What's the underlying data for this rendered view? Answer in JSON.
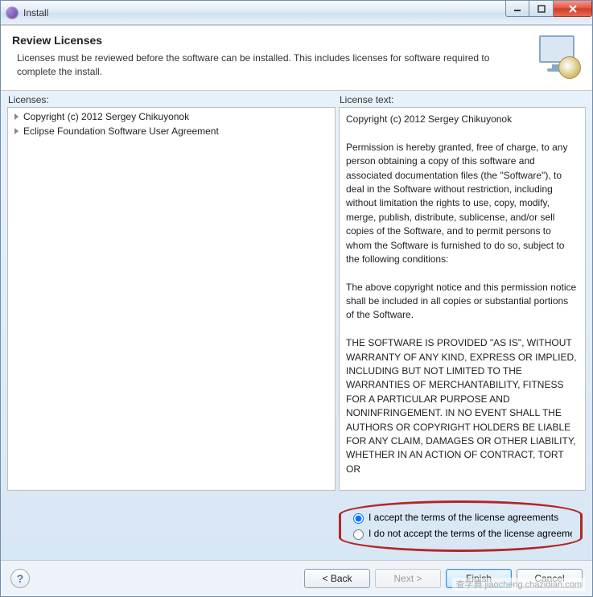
{
  "window": {
    "title": "Install"
  },
  "header": {
    "heading": "Review Licenses",
    "description": "Licenses must be reviewed before the software can be installed.  This includes licenses for software required to complete the install."
  },
  "labels": {
    "licenses": "Licenses:",
    "license_text": "License text:"
  },
  "licenses": {
    "items": [
      {
        "label": "Copyright (c) 2012 Sergey Chikuyonok"
      },
      {
        "label": "Eclipse Foundation Software User Agreement"
      }
    ]
  },
  "license_text": "Copyright (c) 2012 Sergey Chikuyonok\n\nPermission is hereby granted, free of charge, to any person obtaining a copy of this software and associated documentation files (the \"Software\"), to deal in the Software without restriction, including without limitation the rights to use, copy, modify, merge, publish, distribute, sublicense, and/or sell copies of the Software, and to permit persons to whom the Software is furnished to do so, subject to the following conditions:\n\nThe above copyright notice and this permission notice shall be included in all copies or substantial portions of the Software.\n\nTHE SOFTWARE IS PROVIDED \"AS IS\", WITHOUT WARRANTY OF ANY KIND, EXPRESS OR IMPLIED, INCLUDING BUT NOT LIMITED TO THE WARRANTIES OF MERCHANTABILITY, FITNESS FOR A PARTICULAR PURPOSE AND NONINFRINGEMENT. IN NO EVENT SHALL THE AUTHORS OR COPYRIGHT HOLDERS BE LIABLE FOR ANY CLAIM, DAMAGES OR OTHER LIABILITY, WHETHER IN AN ACTION OF CONTRACT, TORT OR",
  "radio": {
    "accept": "I accept the terms of the license agreements",
    "reject": "I do not accept the terms of the license agreements",
    "selected": "accept"
  },
  "buttons": {
    "back": "< Back",
    "next": "Next >",
    "finish": "Finish",
    "cancel": "Cancel"
  },
  "watermark": "查字典  jiaocheng.chazidian.com"
}
